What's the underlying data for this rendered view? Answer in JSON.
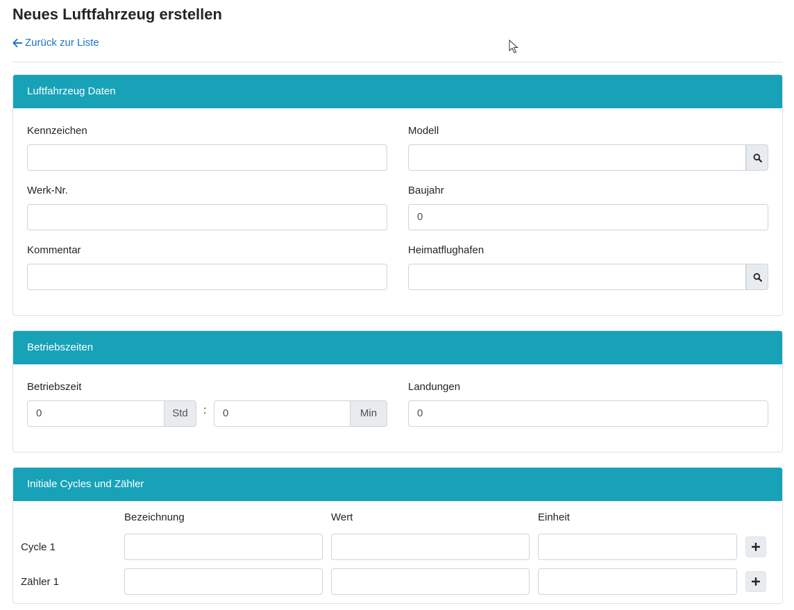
{
  "page": {
    "title": "Neues Luftfahrzeug erstellen",
    "back_link": "Zurück zur Liste"
  },
  "aircraft_card": {
    "header": "Luftfahrzeug Daten",
    "kennzeichen": {
      "label": "Kennzeichen",
      "value": ""
    },
    "modell": {
      "label": "Modell",
      "value": ""
    },
    "werk_nr": {
      "label": "Werk-Nr.",
      "value": ""
    },
    "baujahr": {
      "label": "Baujahr",
      "value": "0"
    },
    "kommentar": {
      "label": "Kommentar",
      "value": ""
    },
    "heimatflughafen": {
      "label": "Heimatflughafen",
      "value": ""
    }
  },
  "operating_card": {
    "header": "Betriebszeiten",
    "betriebszeit": {
      "label": "Betriebszeit",
      "hours_value": "0",
      "hours_unit": "Std",
      "separator": ":",
      "minutes_value": "0",
      "minutes_unit": "Min"
    },
    "landungen": {
      "label": "Landungen",
      "value": "0"
    }
  },
  "cycles_card": {
    "header": "Initiale Cycles und Zähler",
    "columns": [
      "Bezeichnung",
      "Wert",
      "Einheit"
    ],
    "rows": [
      {
        "label": "Cycle 1",
        "bezeichnung": "",
        "wert": "",
        "einheit": ""
      },
      {
        "label": "Zähler 1",
        "bezeichnung": "",
        "wert": "",
        "einheit": ""
      }
    ]
  },
  "colors": {
    "header_bg": "#17a2b8",
    "link": "#1a73c8",
    "addon_bg": "#e9ecef"
  },
  "icons": {
    "back": "arrow-left-icon",
    "search": "search-icon",
    "add": "plus-icon"
  }
}
